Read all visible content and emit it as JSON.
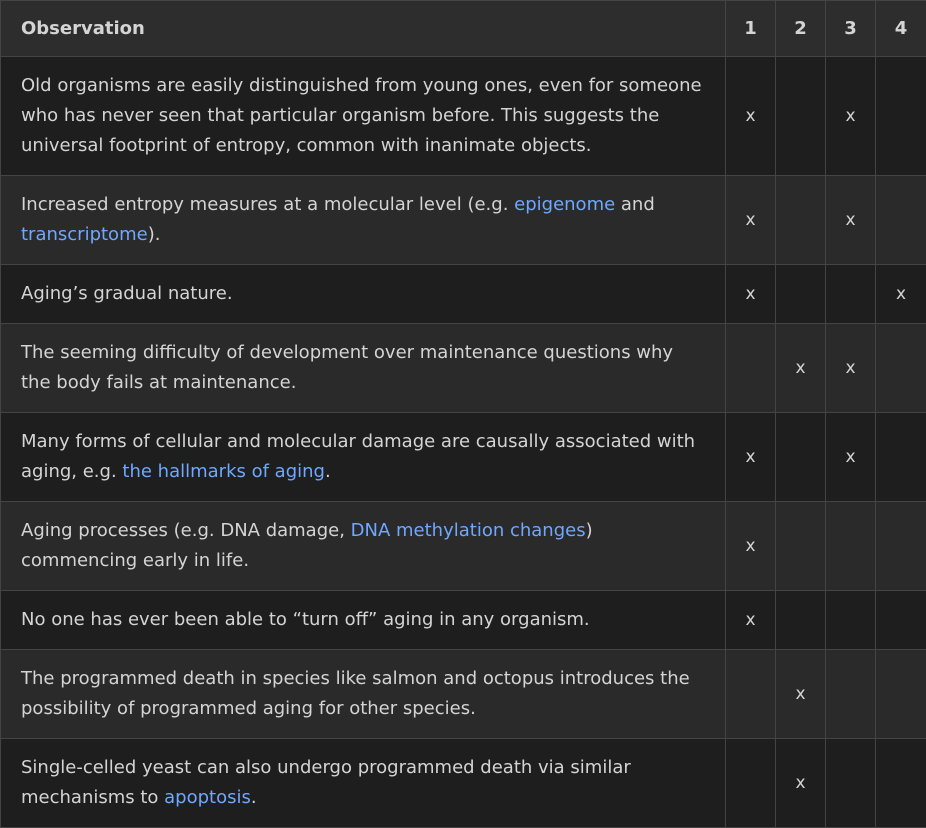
{
  "headers": {
    "observation": "Observation",
    "c1": "1",
    "c2": "2",
    "c3": "3",
    "c4": "4"
  },
  "mark": "x",
  "colors": {
    "link": "#6ea8ff",
    "text": "#d4d4d4",
    "header_bg": "#2d2d2d",
    "row_bg": "#1e1e1e",
    "row_alt_bg": "#2a2a2a",
    "border": "#444444"
  },
  "rows": [
    {
      "t1": "Old organisms are easily distinguished from young ones, even for someone who has never seen that particular organism before. This suggests the universal footprint of entropy, common with inanimate objects.",
      "marks": [
        true,
        false,
        true,
        false
      ]
    },
    {
      "t1": "Increased entropy measures at a molecular level (e.g. ",
      "link1": "epigenome",
      "t2": " and ",
      "link2": "transcriptome",
      "t3": ").",
      "marks": [
        true,
        false,
        true,
        false
      ]
    },
    {
      "t1": "Aging’s gradual nature.",
      "marks": [
        true,
        false,
        false,
        true
      ]
    },
    {
      "t1": "The seeming difficulty of development over maintenance questions why the body fails at maintenance.",
      "marks": [
        false,
        true,
        true,
        false
      ]
    },
    {
      "t1": "Many forms of cellular and molecular damage are causally associated with aging, e.g. ",
      "link1": "the hallmarks of aging",
      "t2": ".",
      "marks": [
        true,
        false,
        true,
        false
      ]
    },
    {
      "t1": "Aging processes (e.g. DNA damage, ",
      "link1": "DNA methylation changes",
      "t2": ") commencing early in life.",
      "marks": [
        true,
        false,
        false,
        false
      ]
    },
    {
      "t1": "No one has ever been able to “turn off” aging in any organism.",
      "marks": [
        true,
        false,
        false,
        false
      ]
    },
    {
      "t1": "The programmed death in species like salmon and octopus introduces the possibility of programmed aging for other species.",
      "marks": [
        false,
        true,
        false,
        false
      ]
    },
    {
      "t1": "Single-celled yeast can also undergo programmed death via similar mechanisms to ",
      "link1": "apoptosis",
      "t2": ".",
      "marks": [
        false,
        true,
        false,
        false
      ]
    }
  ]
}
